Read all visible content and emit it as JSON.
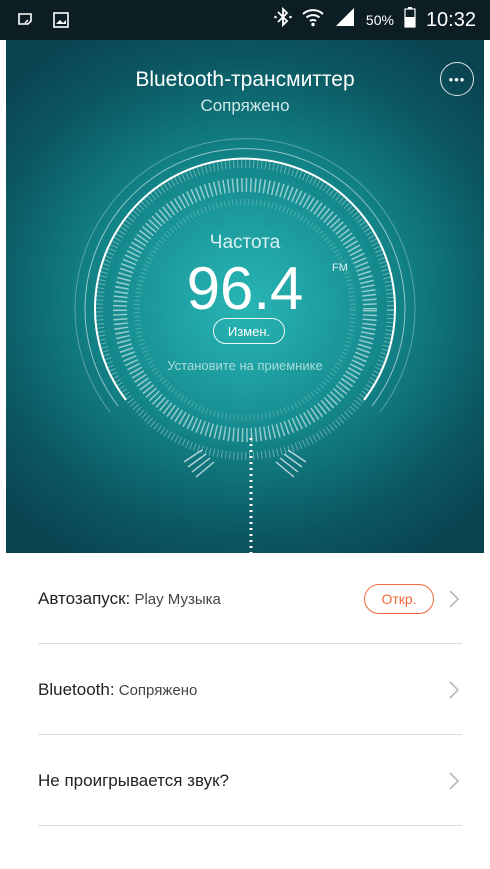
{
  "status_bar": {
    "battery_percent": "50%",
    "time": "10:32",
    "left_icons": [
      "notification-icon",
      "image-icon"
    ],
    "right_icons": [
      "bluetooth-icon",
      "wifi-icon",
      "signal-icon",
      "battery-icon"
    ]
  },
  "hero": {
    "title": "Bluetooth-трансмиттер",
    "subtitle": "Сопряжено",
    "more_button_label": "•••",
    "frequency_label": "Частота",
    "frequency_value": "96.4",
    "frequency_unit": "FM",
    "change_button_label": "Измен.",
    "hint": "Установите на приемнике"
  },
  "list": {
    "rows": [
      {
        "label": "Автозапуск:",
        "value": " Play Музыка",
        "action_label": "Откр."
      },
      {
        "label": "Bluetooth:",
        "value": " Сопряжено"
      },
      {
        "label": "Не проигрывается звук?",
        "value": ""
      }
    ]
  },
  "colors": {
    "accent_orange": "#f06a3c",
    "hero_teal": "#1ea3a5",
    "status_bar": "#0c1e24"
  }
}
